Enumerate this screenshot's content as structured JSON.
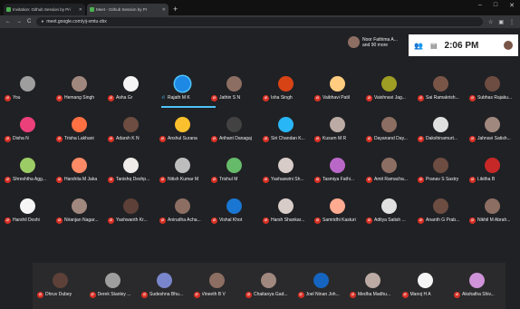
{
  "browser": {
    "tabs": [
      {
        "label": "Invitation: Github Session by Pri",
        "active": false
      },
      {
        "label": "Meet - Github Session by Pr",
        "active": true
      }
    ],
    "url": "meet.google.com/yij-xmtu-zbx"
  },
  "meet": {
    "presenter_text_1": "Noor Fathima A...",
    "presenter_text_2": "and 90 more",
    "clock": "2:06 PM"
  },
  "participants": [
    {
      "name": "You",
      "color": "#9e9e9e"
    },
    {
      "name": "Hemang Singh",
      "color": "#a1887f"
    },
    {
      "name": "Asha Gr",
      "color": "#f5f5f5"
    },
    {
      "name": "Rajath M K",
      "color": "#1e88e5",
      "speaking": true
    },
    {
      "name": "Jathin S N",
      "color": "#8d6e63"
    },
    {
      "name": "Isha Singh",
      "color": "#d84315"
    },
    {
      "name": "Vaibhavi Patil",
      "color": "#ffcc80"
    },
    {
      "name": "Vaishnavi Jag...",
      "color": "#9e9d24"
    },
    {
      "name": "Sai Ramakrish...",
      "color": "#795548"
    },
    {
      "name": "Subhas Rajaku...",
      "color": "#6d4c41"
    },
    {
      "name": "Disha N",
      "color": "#ec407a"
    },
    {
      "name": "Trisha Lakhani",
      "color": "#ff7043"
    },
    {
      "name": "Adarsh K N",
      "color": "#6d4c41"
    },
    {
      "name": "Anshul Surana",
      "color": "#fbc02d"
    },
    {
      "name": "Arihant Danagaj",
      "color": "#424242"
    },
    {
      "name": "Siri Chandan K...",
      "color": "#29b6f6"
    },
    {
      "name": "Kusum M R",
      "color": "#bcaaa4"
    },
    {
      "name": "Dayanand Day...",
      "color": "#8d6e63"
    },
    {
      "name": "Dakshinamurt...",
      "color": "#e0e0e0"
    },
    {
      "name": "Jahnavi Satish...",
      "color": "#a1887f"
    },
    {
      "name": "Shreshtha Agg...",
      "color": "#9ccc65"
    },
    {
      "name": "Harshita M Jaka",
      "color": "#ff8a65"
    },
    {
      "name": "Tanishq Deshp...",
      "color": "#efebe9"
    },
    {
      "name": "Nitish Kumar M",
      "color": "#bdbdbd"
    },
    {
      "name": "Trishul M",
      "color": "#66bb6a"
    },
    {
      "name": "Yashaswini Sh...",
      "color": "#d7ccc8"
    },
    {
      "name": "Tasmiya Fathi...",
      "color": "#ba68c8"
    },
    {
      "name": "Amit Ramacha...",
      "color": "#8d6e63"
    },
    {
      "name": "Pranav S Sastry",
      "color": "#6d4c41"
    },
    {
      "name": "Likitha B",
      "color": "#c62828"
    },
    {
      "name": "Harshil Doshi",
      "color": "#f5f5f5"
    },
    {
      "name": "Niranjan Nagar...",
      "color": "#a1887f"
    },
    {
      "name": "Yashwanth Kr...",
      "color": "#5d4037"
    },
    {
      "name": "Anirudha Acha...",
      "color": "#8d6e63"
    },
    {
      "name": "Vishal Khot",
      "color": "#1976d2"
    },
    {
      "name": "Harsh Shankar...",
      "color": "#d7ccc8"
    },
    {
      "name": "Samridhi Kasturi",
      "color": "#ffab91"
    },
    {
      "name": "Aditya Satish ...",
      "color": "#e0e0e0"
    },
    {
      "name": "Ananth G Prab...",
      "color": "#6d4c41"
    },
    {
      "name": "Nikhil M Abrah...",
      "color": "#8d6e63"
    },
    {
      "name": "Dhruv Dubey",
      "color": "#5d4037"
    },
    {
      "name": "Derek Stanley ...",
      "color": "#9e9e9e"
    },
    {
      "name": "Sudeshna Bhu...",
      "color": "#7986cb"
    },
    {
      "name": "Vineeth B V",
      "color": "#8d6e63"
    },
    {
      "name": "Chaitanya Gad...",
      "color": "#a1887f"
    },
    {
      "name": "Joel Ninan Joh...",
      "color": "#1565c0"
    },
    {
      "name": "Medha Madhu...",
      "color": "#bcaaa4"
    },
    {
      "name": "Manoj H A",
      "color": "#f5f5f5"
    },
    {
      "name": "Akshatha Shiv...",
      "color": "#ce93d8"
    }
  ]
}
